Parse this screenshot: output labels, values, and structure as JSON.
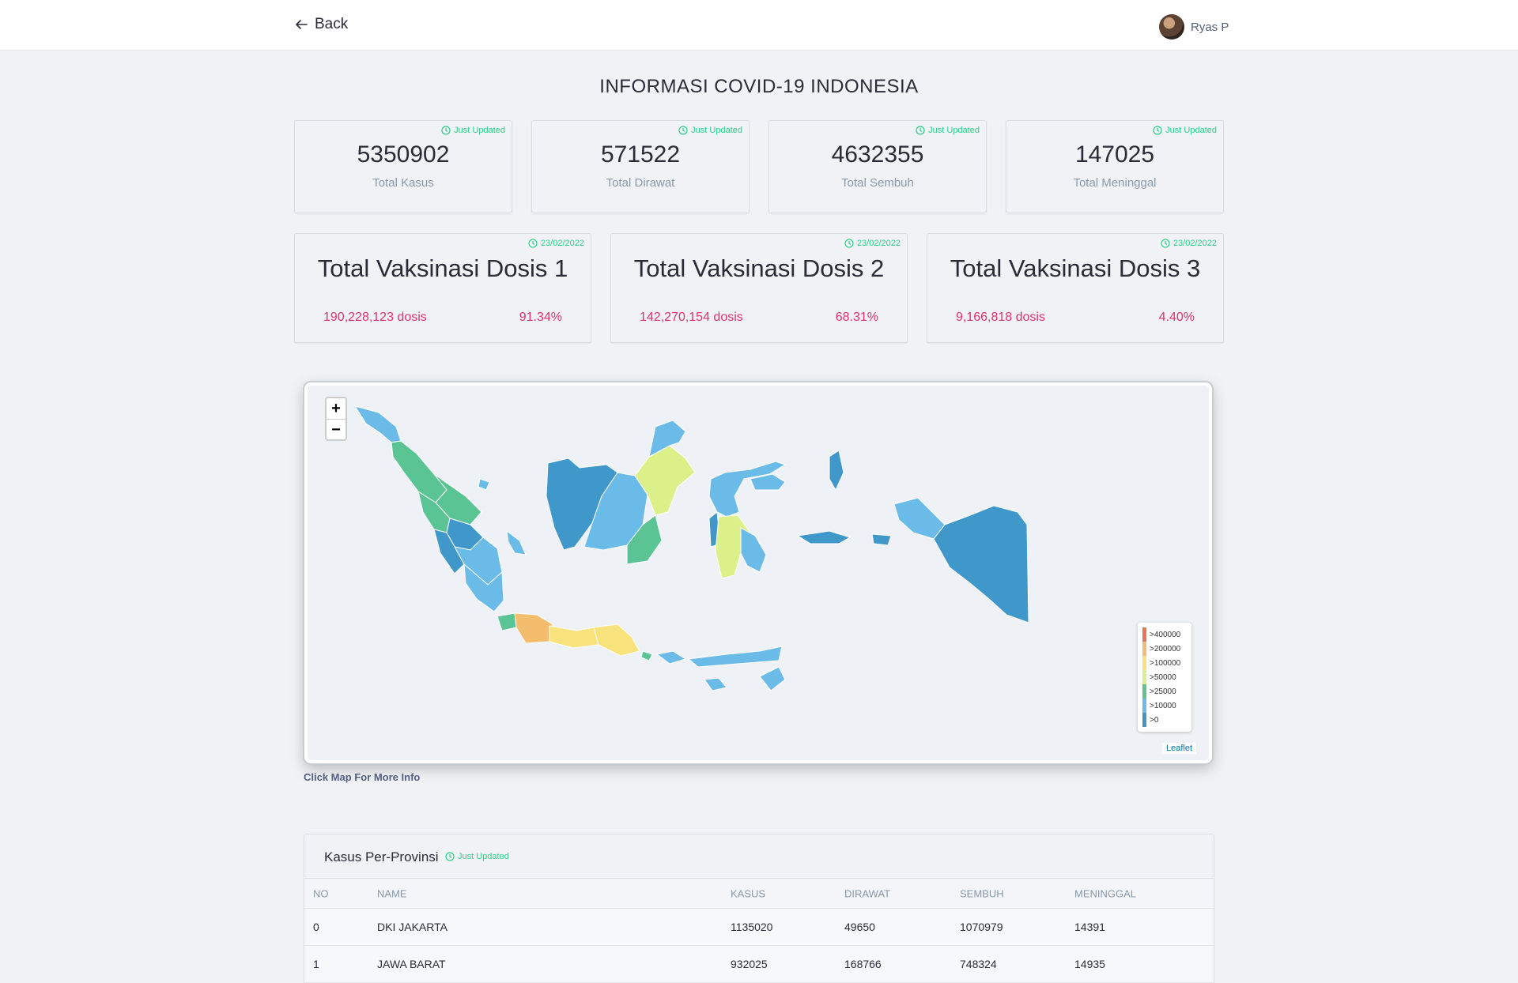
{
  "header": {
    "back_label": "Back",
    "user_name": "Ryas P"
  },
  "page_title": "INFORMASI COVID-19 INDONESIA",
  "stats": [
    {
      "value": "5350902",
      "label": "Total Kasus",
      "badge": "Just Updated"
    },
    {
      "value": "571522",
      "label": "Total Dirawat",
      "badge": "Just Updated"
    },
    {
      "value": "4632355",
      "label": "Total Sembuh",
      "badge": "Just Updated"
    },
    {
      "value": "147025",
      "label": "Total Meninggal",
      "badge": "Just Updated"
    }
  ],
  "vaccines": [
    {
      "title": "Total Vaksinasi Dosis 1",
      "dosis": "190,228,123 dosis",
      "percent": "91.34%",
      "badge": "23/02/2022"
    },
    {
      "title": "Total Vaksinasi Dosis 2",
      "dosis": "142,270,154 dosis",
      "percent": "68.31%",
      "badge": "23/02/2022"
    },
    {
      "title": "Total Vaksinasi Dosis 3",
      "dosis": "9,166,818 dosis",
      "percent": "4.40%",
      "badge": "23/02/2022"
    }
  ],
  "map": {
    "zoom_in": "+",
    "zoom_out": "−",
    "attribution": "Leaflet",
    "legend": [
      {
        "label": ">400000",
        "color": "#e8735f"
      },
      {
        "label": ">200000",
        "color": "#f4bd6e"
      },
      {
        "label": ">100000",
        "color": "#f8e27c"
      },
      {
        "label": ">50000",
        "color": "#dcf089"
      },
      {
        "label": ">25000",
        "color": "#5bc494"
      },
      {
        "label": ">10000",
        "color": "#6bbbe8"
      },
      {
        "label": ">0",
        "color": "#4097c9"
      }
    ],
    "note": "Click Map For More Info"
  },
  "table": {
    "title": "Kasus Per-Provinsi",
    "badge": "Just Updated",
    "columns": [
      "NO",
      "NAME",
      "KASUS",
      "DIRAWAT",
      "SEMBUH",
      "MENINGGAL"
    ],
    "rows": [
      [
        "0",
        "DKI JAKARTA",
        "1135020",
        "49650",
        "1070979",
        "14391"
      ],
      [
        "1",
        "JAWA BARAT",
        "932025",
        "168766",
        "748324",
        "14935"
      ]
    ]
  }
}
